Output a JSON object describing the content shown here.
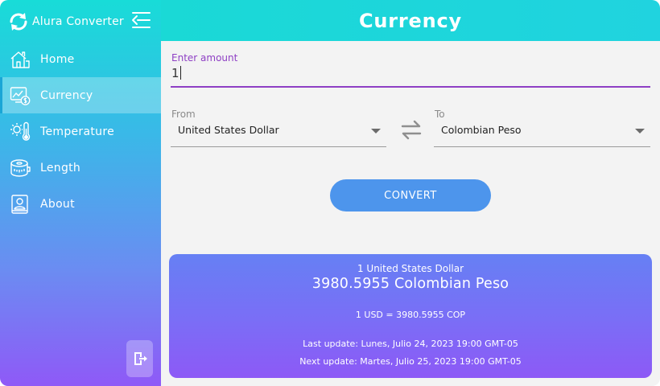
{
  "app": {
    "name": "Alura Converter"
  },
  "header": {
    "title": "Currency"
  },
  "sidebar": {
    "items": [
      {
        "label": "Home",
        "icon": "home-icon"
      },
      {
        "label": "Currency",
        "icon": "currency-chart-icon",
        "active": true
      },
      {
        "label": "Temperature",
        "icon": "temperature-icon"
      },
      {
        "label": "Length",
        "icon": "measuring-tape-icon"
      },
      {
        "label": "About",
        "icon": "profile-card-icon"
      }
    ],
    "logout_icon": "logout-icon"
  },
  "form": {
    "amount_label": "Enter amount",
    "amount_value": "1",
    "from_label": "From",
    "from_value": "United States Dollar",
    "to_label": "To",
    "to_value": "Colombian Peso",
    "convert_label": "CONVERT"
  },
  "result": {
    "from_text": "1 United States Dollar",
    "to_text": "3980.5955 Colombian Peso",
    "rate_text": "1 USD = 3980.5955 COP",
    "last_update": "Last update: Lunes, Julio 24, 2023 19:00 GMT-05",
    "next_update": "Next update: Martes, Julio 25, 2023 19:00 GMT-05"
  },
  "colors": {
    "accent_purple": "#8e3fc4",
    "button_blue": "#4d95ec",
    "header_cyan": "#1ad9d6",
    "card_gradient_start": "#6680f4",
    "card_gradient_end": "#8d59f6"
  }
}
